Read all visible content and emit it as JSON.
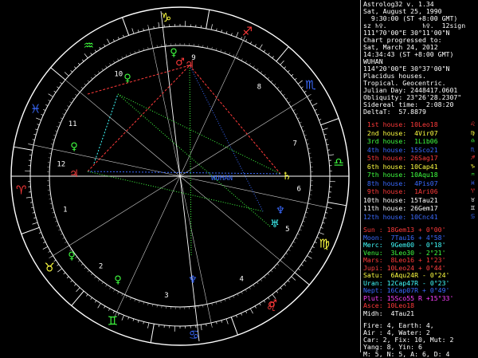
{
  "header": [
    "Astrolog32 v. 1.34",
    "Sat, August 25, 1990",
    "  9:30:00 (ST +8:00 GMT)",
    "sz ♄♀.         ♄♀.  12sign",
    "111°70'00\"E 30°11'00\"N",
    "Chart progressed to:",
    "Sat, March 24, 2012",
    "14:34:43 (ST +8:00 GMT)",
    "WUHAN",
    "114°20'00\"E 30°37'00\"N",
    "Placidus houses.",
    "Tropical. Geocentric.",
    "Julian Day: 2448417.0601",
    "Obliquity: 23°26'28.2307\"",
    "Sidereal time:  2:08:20",
    "DeltaT:  57.8879"
  ],
  "houses": [
    {
      "label": "1st house:",
      "value": "10Leo18",
      "color": "#ff3a3a",
      "sym": "♌"
    },
    {
      "label": "2nd house:",
      "value": " 4Vir07",
      "color": "#ffff40",
      "sym": "♍"
    },
    {
      "label": "3rd house:",
      "value": " 1Lib06",
      "color": "#40ff40",
      "sym": "♎"
    },
    {
      "label": "4th house:",
      "value": "15Sco21",
      "color": "#3a6aff",
      "sym": "♏"
    },
    {
      "label": "5th house:",
      "value": "26Sag17",
      "color": "#ff3a3a",
      "sym": "♐"
    },
    {
      "label": "6th house:",
      "value": "10Cap41",
      "color": "#ffff40",
      "sym": "♑"
    },
    {
      "label": "7th house:",
      "value": "10Aqu18",
      "color": "#40ff40",
      "sym": "♒"
    },
    {
      "label": "8th house:",
      "value": " 4Pis07",
      "color": "#3a6aff",
      "sym": "♓"
    },
    {
      "label": "9th house:",
      "value": " 1Ari06",
      "color": "#ff3a3a",
      "sym": "♈"
    },
    {
      "label": "10th house:",
      "value": "15Tau21",
      "color": "#ffffff",
      "sym": "♉"
    },
    {
      "label": "11th house:",
      "value": "26Gem17",
      "color": "#ffffff",
      "sym": "♊"
    },
    {
      "label": "12th house:",
      "value": "10Cnc41",
      "color": "#3a6aff",
      "sym": "♋"
    }
  ],
  "planets": [
    {
      "name": "Sun :",
      "pos": "18Gem13",
      "mot": " + 0°00'",
      "color": "#ff3a3a"
    },
    {
      "name": "Moon:",
      "pos": " 7Tau16",
      "mot": " + 4°58'",
      "color": "#3a6aff"
    },
    {
      "name": "Merc:",
      "pos": " 9Gem00",
      "mot": " - 0°18'",
      "color": "#40ffff"
    },
    {
      "name": "Venu:",
      "pos": " 3Leo30",
      "mot": " - 2°21'",
      "color": "#40ff40"
    },
    {
      "name": "Mars:",
      "pos": " 8Leo16",
      "mot": " + 1°23'",
      "color": "#ff3a3a"
    },
    {
      "name": "Jupi:",
      "pos": "10Leo24",
      "mot": " + 0°44'",
      "color": "#ff4040"
    },
    {
      "name": "Satu:",
      "pos": " 6Aqu24R",
      "mot": " - 0°24'",
      "color": "#ffff40"
    },
    {
      "name": "Uran:",
      "pos": "12Cap47R",
      "mot": " - 0°23'",
      "color": "#40ffff"
    },
    {
      "name": "Nept:",
      "pos": "16Cap07R",
      "mot": " + 0°49'",
      "color": "#3a6aff"
    },
    {
      "name": "Plut:",
      "pos": "15Sco55",
      "mot": " R +15°33'",
      "color": "#ff40ff"
    },
    {
      "name": "Asce:",
      "pos": "10Leo18",
      "mot": "",
      "color": "#ff3a3a"
    },
    {
      "name": "Midh:",
      "pos": " 4Tau21",
      "mot": "",
      "color": "#ffffff"
    }
  ],
  "summary": [
    "Fire: 4, Earth: 4,",
    "Air : 4, Water: 2",
    "Car: 2, Fix: 10, Mut: 2",
    "Yang: 8, Yin: 6",
    "M: 5, N: 5, A: 6, D: 4"
  ],
  "wheel": {
    "signs": [
      "♈",
      "♉",
      "♊",
      "♋",
      "♌",
      "♍",
      "♎",
      "♏",
      "♐",
      "♑",
      "♒",
      "♓"
    ],
    "sign_colors": [
      "#ff3a3a",
      "#ffff40",
      "#40ff40",
      "#3a6aff",
      "#ff3a3a",
      "#ffff40",
      "#40ff40",
      "#3a6aff",
      "#ff3a3a",
      "#ffff40",
      "#40ff40",
      "#3a6aff"
    ],
    "house_numbers": [
      "1",
      "2",
      "3",
      "4",
      "5",
      "6",
      "7",
      "8",
      "9",
      "10",
      "11",
      "12"
    ],
    "center_label": "WUHAN",
    "planet_glyphs": [
      "☉",
      "☽",
      "☿",
      "♀",
      "♂",
      "♃",
      "♄",
      "♅",
      "♆",
      "♇"
    ]
  }
}
